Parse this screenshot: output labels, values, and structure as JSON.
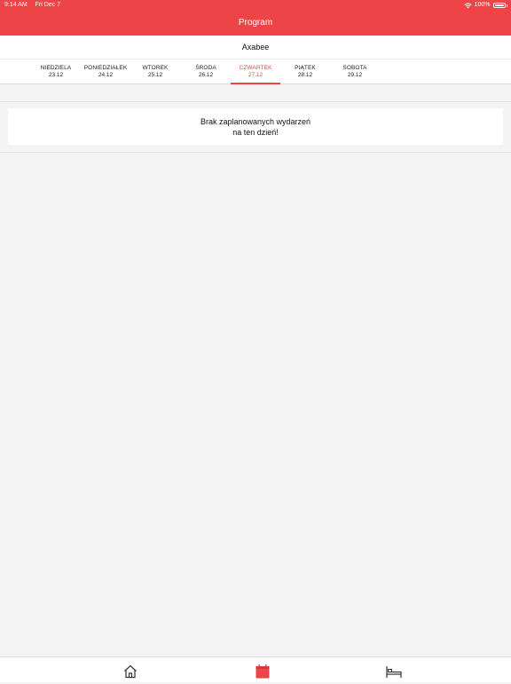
{
  "status_bar": {
    "time": "9:14 AM",
    "date": "Fri Dec 7",
    "battery": "100%"
  },
  "nav": {
    "title": "Program"
  },
  "subtitle": "Axabee",
  "days": [
    {
      "name": "NIEDZIELA",
      "date": "23.12"
    },
    {
      "name": "PONIEDZIAŁEK",
      "date": "24.12"
    },
    {
      "name": "WTOREK",
      "date": "25.12"
    },
    {
      "name": "ŚRODA",
      "date": "26.12"
    },
    {
      "name": "CZWARTEK",
      "date": "27.12",
      "active": true
    },
    {
      "name": "PIĄTEK",
      "date": "28.12"
    },
    {
      "name": "SOBOTA",
      "date": "29.12"
    }
  ],
  "empty_message": {
    "line1": "Brak zaplanowanych wydarzeń",
    "line2": "na ten dzień!"
  },
  "tab_bar": {
    "items": [
      {
        "icon": "home-icon"
      },
      {
        "icon": "calendar-icon",
        "active": true
      },
      {
        "icon": "bed-icon"
      }
    ]
  },
  "colors": {
    "accent": "#ee4448",
    "background": "#f3f3f3"
  }
}
